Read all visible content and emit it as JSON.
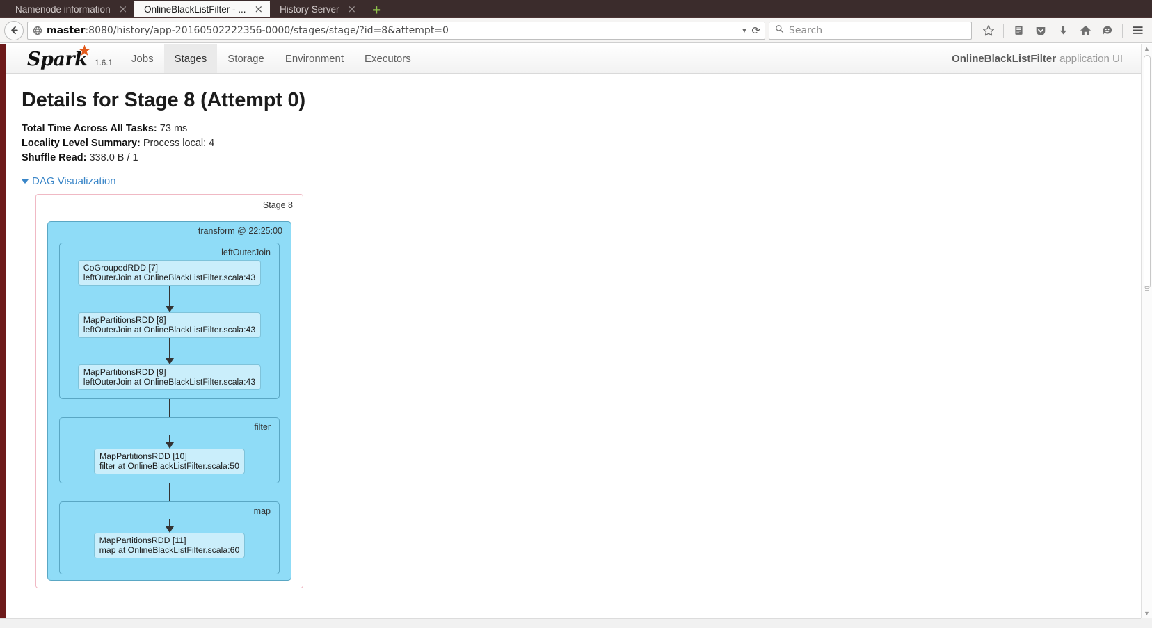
{
  "browser": {
    "tabs": [
      {
        "title": "Namenode information",
        "active": false,
        "close_label": "×"
      },
      {
        "title": "OnlineBlackListFilter - ...",
        "active": true,
        "close_label": "×"
      },
      {
        "title": "History Server",
        "active": false,
        "close_label": "×"
      }
    ],
    "new_tab_label": "+",
    "back_icon": "back-arrow-icon",
    "url": {
      "host": "master",
      "rest": ":8080/history/app-20160502222356-0000/stages/stage/?id=8&attempt=0",
      "full": "master:8080/history/app-20160502222356-0000/stages/stage/?id=8&attempt=0",
      "dropdown_icon": "chevron-down-icon",
      "reload_icon": "reload-icon",
      "identity_icon": "globe-icon"
    },
    "search": {
      "placeholder": "Search",
      "icon": "search-icon"
    },
    "toolbar_icons": [
      "bookmark-star-icon",
      "reading-list-icon",
      "pocket-icon",
      "downloads-icon",
      "home-icon",
      "hello-chat-icon",
      "hamburger-menu-icon"
    ]
  },
  "spark": {
    "brand": {
      "word": "Spark",
      "star_icon": "spark-star-icon",
      "version": "1.6.1"
    },
    "nav_items": [
      {
        "label": "Jobs",
        "active": false
      },
      {
        "label": "Stages",
        "active": true
      },
      {
        "label": "Storage",
        "active": false
      },
      {
        "label": "Environment",
        "active": false
      },
      {
        "label": "Executors",
        "active": false
      }
    ],
    "app_title": {
      "name": "OnlineBlackListFilter",
      "suffix": "application UI"
    }
  },
  "page": {
    "title": "Details for Stage 8 (Attempt 0)",
    "summary": [
      {
        "label": "Total Time Across All Tasks:",
        "value": "73 ms"
      },
      {
        "label": "Locality Level Summary:",
        "value": "Process local: 4"
      },
      {
        "label": "Shuffle Read:",
        "value": "338.0 B / 1"
      }
    ],
    "dag_toggle_label": "DAG Visualization"
  },
  "dag": {
    "stage_label": "Stage 8",
    "transform_label": "transform @ 22:25:00",
    "clusters": [
      {
        "label": "leftOuterJoin",
        "nodes": [
          {
            "name": "CoGroupedRDD [7]",
            "call": "leftOuterJoin at OnlineBlackListFilter.scala:43"
          },
          {
            "name": "MapPartitionsRDD [8]",
            "call": "leftOuterJoin at OnlineBlackListFilter.scala:43"
          },
          {
            "name": "MapPartitionsRDD [9]",
            "call": "leftOuterJoin at OnlineBlackListFilter.scala:43"
          }
        ]
      },
      {
        "label": "filter",
        "nodes": [
          {
            "name": "MapPartitionsRDD [10]",
            "call": "filter at OnlineBlackListFilter.scala:50"
          }
        ]
      },
      {
        "label": "map",
        "nodes": [
          {
            "name": "MapPartitionsRDD [11]",
            "call": "map at OnlineBlackListFilter.scala:60"
          }
        ]
      }
    ]
  },
  "colors": {
    "tabstrip_bg": "#3b2c2c",
    "accent_link": "#3a86c8",
    "stage_border": "#f0b9c4",
    "cluster_bg": "#8fdcf7",
    "node_bg": "#caeefb",
    "spark_star": "#e25a1c",
    "left_rail": "#6d1a1a"
  }
}
